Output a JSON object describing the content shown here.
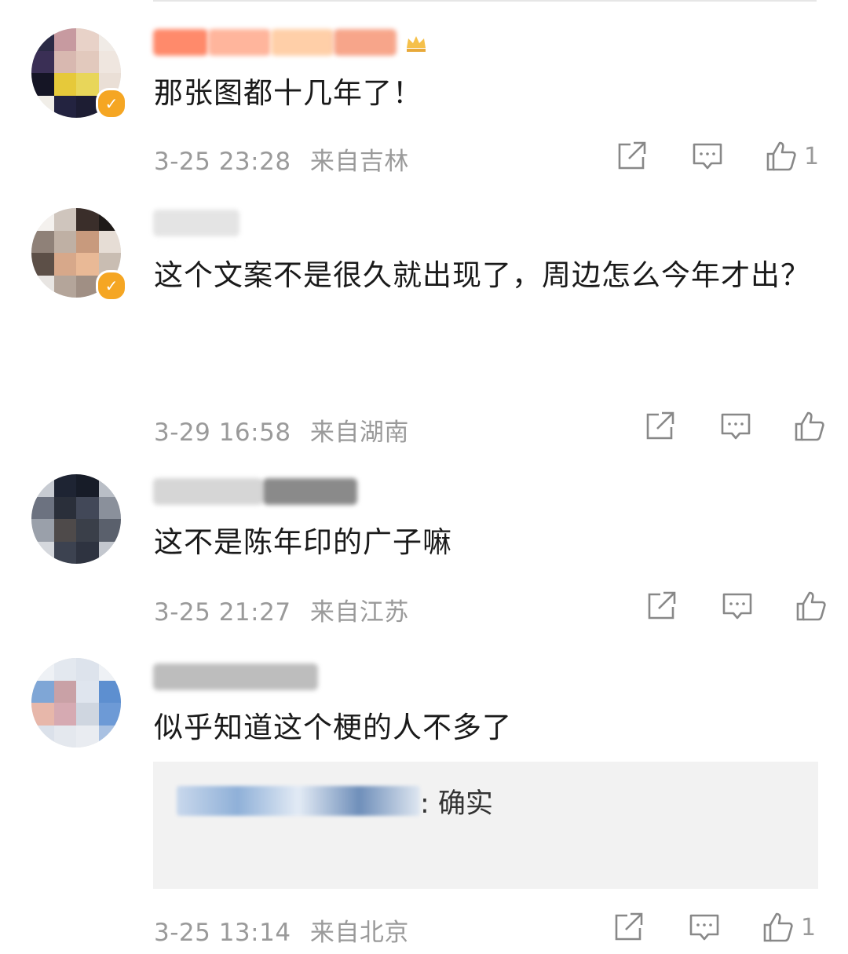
{
  "comments": [
    {
      "text": "那张图都十几年了！",
      "date": "3-25 23:28",
      "location": "来自吉林",
      "likes": "1",
      "verified": true
    },
    {
      "text": "这个文案不是很久就出现了，周边怎么今年才出？",
      "date": "3-29 16:58",
      "location": "来自湖南",
      "likes": "",
      "verified": true
    },
    {
      "text": "这不是陈年印的广子嘛",
      "date": "3-25 21:27",
      "location": "来自江苏",
      "likes": "",
      "verified": false
    },
    {
      "text": "似乎知道这个梗的人不多了",
      "date": "3-25 13:14",
      "location": "来自北京",
      "likes": "1",
      "verified": false,
      "reply": {
        "text": ": 确实"
      }
    }
  ],
  "icons": {
    "share": "share-icon",
    "comment": "comment-icon",
    "like": "thumbs-up-icon"
  },
  "colors": {
    "verified_badge": "#f5a623",
    "meta_text": "#9a9a9a",
    "reply_bg": "#f2f2f2"
  }
}
